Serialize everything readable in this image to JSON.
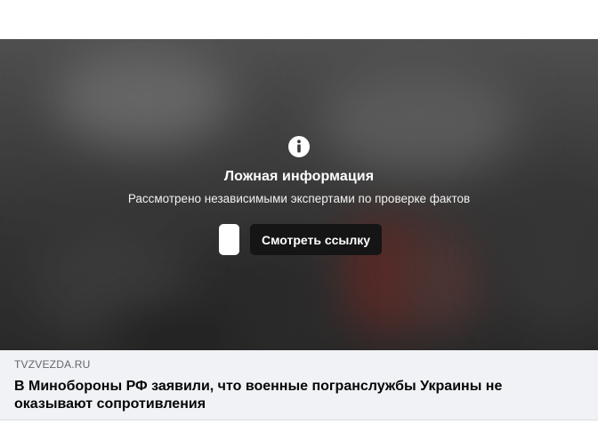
{
  "warning": {
    "icon": "info-icon",
    "title": "Ложная информация",
    "subtitle": "Рассмотрено независимыми экспертами по проверке фактов",
    "see_link_label": "Смотреть ссылку"
  },
  "link_preview": {
    "domain": "TVZVEZDA.RU",
    "headline": "В Минобороны РФ заявили, что военные погранслужбы Украины не оказывают сопротивления"
  },
  "colors": {
    "card_background": "#f0f2f5",
    "button_background": "#151515",
    "text_primary": "#050505",
    "text_secondary": "#65676b"
  }
}
